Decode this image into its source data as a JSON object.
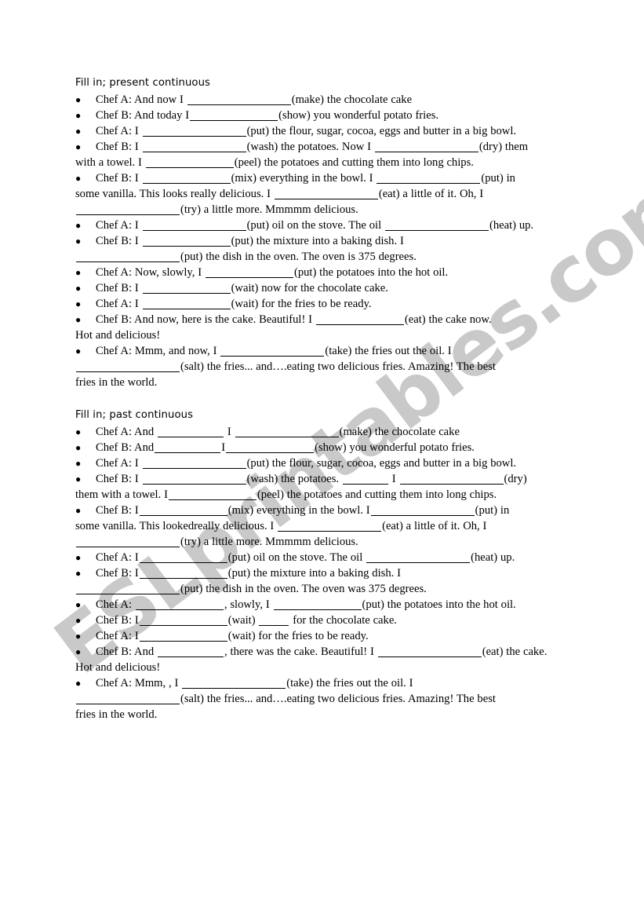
{
  "watermark": {
    "text": "ESLprintables.com",
    "color": "#c9c9c9"
  },
  "sections": [
    {
      "title": "Fill in; present continuous",
      "lines": [
        {
          "bullet": true,
          "parts": [
            "Chef A: And now I ",
            "BLANK_XL",
            "(make) the chocolate cake"
          ]
        },
        {
          "bullet": true,
          "parts": [
            "Chef B: And today I",
            "BLANK_LG",
            "(show) you wonderful potato fries."
          ]
        },
        {
          "bullet": true,
          "parts": [
            "Chef A: I ",
            "BLANK_XL",
            "(put) the flour, sugar, cocoa, eggs and butter in a big bowl."
          ]
        },
        {
          "bullet": true,
          "parts": [
            "Chef B: I ",
            "BLANK_XL",
            "(wash) the potatoes. Now I ",
            "BLANK_XL",
            "(dry) them"
          ]
        },
        {
          "bullet": false,
          "parts": [
            "with a towel. I ",
            "BLANK_LG",
            "(peel) the potatoes and cutting them into long chips."
          ]
        },
        {
          "bullet": true,
          "parts": [
            "Chef B: I ",
            "BLANK_LG",
            "(mix) everything in the bowl. I ",
            "BLANK_XL",
            "(put) in"
          ]
        },
        {
          "bullet": false,
          "parts": [
            "some vanilla. This looks really delicious. I ",
            "BLANK_XL",
            "(eat) a little of it. Oh, I"
          ]
        },
        {
          "bullet": false,
          "parts": [
            "BLANK_XL",
            "(try) a little more. Mmmmm delicious."
          ]
        },
        {
          "bullet": true,
          "parts": [
            "Chef A: I ",
            "BLANK_XL",
            "(put) oil on the stove. The oil ",
            "BLANK_XL",
            "(heat) up."
          ]
        },
        {
          "bullet": true,
          "parts": [
            "Chef B: I ",
            "BLANK_LG",
            "(put) the mixture into a baking dish. I"
          ]
        },
        {
          "bullet": false,
          "parts": [
            "BLANK_XL",
            "(put) the dish in the oven. The oven is 375 degrees."
          ]
        },
        {
          "bullet": true,
          "parts": [
            "Chef A: Now, slowly, I ",
            "BLANK_LG",
            "(put) the potatoes into the hot oil."
          ]
        },
        {
          "bullet": true,
          "parts": [
            "Chef B: I ",
            "BLANK_LG",
            "(wait) now for the chocolate cake."
          ]
        },
        {
          "bullet": true,
          "parts": [
            "Chef A: I ",
            "BLANK_LG",
            "(wait) for the fries to be ready."
          ]
        },
        {
          "bullet": true,
          "parts": [
            "Chef B: And now, here is the cake. Beautiful! I ",
            "BLANK_LG",
            "(eat) the cake now."
          ]
        },
        {
          "bullet": false,
          "parts": [
            "Hot and delicious!"
          ]
        },
        {
          "bullet": true,
          "parts": [
            "Chef A: Mmm, and now, I ",
            "BLANK_XL",
            "(take) the fries out the oil. I"
          ]
        },
        {
          "bullet": false,
          "parts": [
            "BLANK_XL",
            "(salt) the fries... and….eating two delicious fries. Amazing! The best"
          ]
        },
        {
          "bullet": false,
          "parts": [
            "fries in the world."
          ]
        }
      ]
    },
    {
      "title": "Fill in; past continuous",
      "lines": [
        {
          "bullet": true,
          "parts": [
            "Chef A: And ",
            "BLANK_MD",
            " I ",
            "BLANK_XL",
            "(make) the chocolate cake"
          ]
        },
        {
          "bullet": true,
          "parts": [
            "Chef B: And",
            "BLANK_MD",
            "I",
            "BLANK_LG",
            "(show) you wonderful potato fries."
          ]
        },
        {
          "bullet": true,
          "parts": [
            "Chef A: I ",
            "BLANK_XL",
            "(put) the flour, sugar, cocoa, eggs and butter in a big bowl."
          ]
        },
        {
          "bullet": true,
          "parts": [
            "Chef B: I ",
            "BLANK_XL",
            "(wash) the potatoes. ",
            "BLANK_SM",
            " I ",
            "BLANK_XL",
            "(dry)"
          ]
        },
        {
          "bullet": false,
          "parts": [
            "them with a towel. I",
            "BLANK_LG",
            "(peel) the potatoes and cutting them into long chips."
          ]
        },
        {
          "bullet": true,
          "parts": [
            "Chef B: I",
            "BLANK_LG",
            "(mix) everything in the bowl. I",
            "BLANK_XL",
            "(put) in"
          ]
        },
        {
          "bullet": false,
          "parts": [
            "some vanilla. This lookedreally delicious. I ",
            "BLANK_XL",
            "(eat) a little of it. Oh, I"
          ]
        },
        {
          "bullet": false,
          "parts": [
            "BLANK_XL",
            "(try) a little more. Mmmmm delicious."
          ]
        },
        {
          "bullet": true,
          "parts": [
            "Chef A: I",
            "BLANK_LG",
            "(put) oil on the stove. The oil ",
            "BLANK_XL",
            "(heat) up."
          ]
        },
        {
          "bullet": true,
          "parts": [
            "Chef B: I",
            "BLANK_LG",
            "(put) the mixture into a baking dish. I"
          ]
        },
        {
          "bullet": false,
          "parts": [
            "BLANK_XL",
            "(put) the dish in the oven. The oven was 375 degrees."
          ]
        },
        {
          "bullet": true,
          "parts": [
            "Chef A: ",
            "BLANK_LG",
            ", slowly, I ",
            "BLANK_LG",
            "(put) the potatoes into the hot oil."
          ]
        },
        {
          "bullet": true,
          "parts": [
            "Chef B: I",
            "BLANK_LG",
            "(wait) ",
            "BLANK_XS",
            " for the chocolate cake."
          ]
        },
        {
          "bullet": true,
          "parts": [
            "Chef A: I",
            "BLANK_LG",
            "(wait) for the fries to be ready."
          ]
        },
        {
          "bullet": true,
          "parts": [
            "Chef B: And ",
            "BLANK_MD",
            ", there was the cake. Beautiful! I ",
            "BLANK_XL",
            "(eat) the cake."
          ]
        },
        {
          "bullet": false,
          "parts": [
            "Hot and delicious!"
          ]
        },
        {
          "bullet": true,
          "parts": [
            "Chef A: Mmm, , I ",
            "BLANK_XL",
            "(take) the fries out the oil. I"
          ]
        },
        {
          "bullet": false,
          "parts": [
            "BLANK_XL",
            "(salt) the fries... and….eating two delicious fries. Amazing! The best"
          ]
        },
        {
          "bullet": false,
          "parts": [
            "fries in the world."
          ]
        }
      ]
    }
  ]
}
